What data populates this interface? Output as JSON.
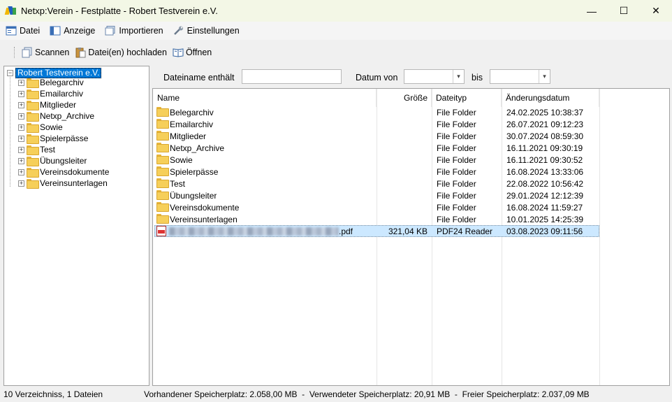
{
  "window": {
    "title": "Netxp:Verein - Festplatte - Robert Testverein e.V.",
    "minimize": "—",
    "maximize": "☐",
    "close": "✕"
  },
  "menu": [
    {
      "label": "Datei",
      "icon": "datei-icon"
    },
    {
      "label": "Anzeige",
      "icon": "anzeige-icon"
    },
    {
      "label": "Importieren",
      "icon": "importieren-icon"
    },
    {
      "label": "Einstellungen",
      "icon": "wrench-icon"
    }
  ],
  "toolbar": [
    {
      "label": "Scannen",
      "icon": "scanner-icon"
    },
    {
      "label": "Datei(en) hochladen",
      "icon": "clipboard-icon"
    },
    {
      "label": "Öffnen",
      "icon": "open-book-icon"
    }
  ],
  "tree": {
    "root": "Robert Testverein e.V.",
    "expander_root": "−",
    "expander_child": "+",
    "children": [
      "Belegarchiv",
      "Emailarchiv",
      "Mitglieder",
      "Netxp_Archive",
      "Sowie",
      "Spielerpässe",
      "Test",
      "Übungsleiter",
      "Vereinsdokumente",
      "Vereinsunterlagen"
    ]
  },
  "filter": {
    "name_label": "Dateiname enthält",
    "name_value": "",
    "date_from_label": "Datum von",
    "date_from_value": "",
    "date_to_label": "bis",
    "date_to_value": "",
    "dropdown_glyph": "▾"
  },
  "columns": {
    "name": "Name",
    "size": "Größe",
    "type": "Dateityp",
    "modified": "Änderungsdatum"
  },
  "files": [
    {
      "name": "Belegarchiv",
      "size": "",
      "type": "File Folder",
      "modified": "24.02.2025 10:38:37"
    },
    {
      "name": "Emailarchiv",
      "size": "",
      "type": "File Folder",
      "modified": "26.07.2021 09:12:23"
    },
    {
      "name": "Mitglieder",
      "size": "",
      "type": "File Folder",
      "modified": "30.07.2024 08:59:30"
    },
    {
      "name": "Netxp_Archive",
      "size": "",
      "type": "File Folder",
      "modified": "16.11.2021 09:30:19"
    },
    {
      "name": "Sowie",
      "size": "",
      "type": "File Folder",
      "modified": "16.11.2021 09:30:52"
    },
    {
      "name": "Spielerpässe",
      "size": "",
      "type": "File Folder",
      "modified": "16.08.2024 13:33:06"
    },
    {
      "name": "Test",
      "size": "",
      "type": "File Folder",
      "modified": "22.08.2022 10:56:42"
    },
    {
      "name": "Übungsleiter",
      "size": "",
      "type": "File Folder",
      "modified": "29.01.2024 12:12:39"
    },
    {
      "name": "Vereinsdokumente",
      "size": "",
      "type": "File Folder",
      "modified": "16.08.2024 11:59:27"
    },
    {
      "name": "Vereinsunterlagen",
      "size": "",
      "type": "File Folder",
      "modified": "10.01.2025 14:25:39"
    }
  ],
  "selected_file": {
    "name_suffix": ".pdf",
    "size": "321,04 KB",
    "type": "PDF24 Reader",
    "modified": "03.08.2023 09:11:56"
  },
  "status": {
    "left": "10 Verzeichniss, 1 Dateien",
    "right": "Vorhandener Speicherplatz: 2.058,00 MB  -  Verwendeter Speicherplatz: 20,91 MB  -  Freier Speicherplatz: 2.037,09 MB"
  }
}
